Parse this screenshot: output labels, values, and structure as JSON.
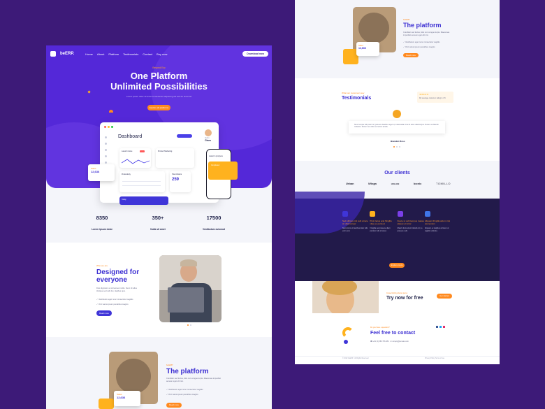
{
  "colors": {
    "background": "#3d1a78",
    "primary": "#5428d8",
    "accent": "#ff8a1f",
    "heading": "#3b2ed2"
  },
  "left": {
    "nav": {
      "logo": "beERP.",
      "items": [
        "Home",
        "About",
        "Platform",
        "Testimonials",
        "Contact",
        "Buy now"
      ],
      "cta": "Download now"
    },
    "hero": {
      "eyebrow": "Beyond Erp",
      "title_line1": "One Platform",
      "title_line2": "Unlimited Possibilities",
      "subtitle": "Lorem ipsum dolor sit amet consectetur adipiscing elit sed do eiusmod",
      "button": "Explore all platforms"
    },
    "dashboard": {
      "title": "Dashboard",
      "user_greeting": "Hello",
      "user_name": "Clara",
      "card1": "Latest Invoice",
      "card2": "Product Marketing",
      "card3": "Productivity",
      "card4": "Total Visitors",
      "metric": "259",
      "bottom_bar": "Today",
      "phone_card": "Latest in progress",
      "phone_status": "Completed"
    },
    "sales_card": {
      "label": "Sales",
      "value": "12,636"
    },
    "stats": [
      {
        "value": "8350",
        "label": "Lorem ipsum dolor"
      },
      {
        "value": "350+",
        "label": "Nulla sit amet"
      },
      {
        "value": "17500",
        "label": "Vestibulum euismod"
      }
    ],
    "designed": {
      "eyebrow": "Who we are",
      "title": "Designed for everyone",
      "text": "Duis dignissim et sit laoreet mollis. Nunc id tellus tristique sed velit dui, dapibus quis.",
      "checks": [
        "Vestibulum eget nunc consectetur sagittis",
        "Orci varius ipsum penatibus magnis"
      ],
      "button": "Read more"
    },
    "platform": {
      "eyebrow": "beERP",
      "title": "The platform",
      "text": "Curabitur sed luctus, felis non congue turpis. Maecenas imperdiet aenean eget elit nisi.",
      "checks": [
        "Vestibulum eget nunc consectetur sagittis",
        "Orci varius ipsum penatibus magnis"
      ],
      "button": "Read more",
      "sales_label": "Sales",
      "sales_value": "12,636"
    }
  },
  "right": {
    "platform": {
      "eyebrow": "beERP",
      "title": "The platform",
      "text": "Curabitur sed luctus, felis non congue turpis. Maecenas imperdiet aenean eget elit nisi.",
      "checks": [
        "Vestibulum eget nunc consectetur sagittis",
        "Orci varius ipsum penatibus magnis"
      ],
      "button": "Read more",
      "sales_label": "Sales",
      "sales_value": "12,636"
    },
    "testimonials": {
      "eyebrow": "What our customers say",
      "title": "Testimonials",
      "rating_text": "My average customer rating is 4.5",
      "quote": "Nunc tempor elit ipsum sit, posuere faucibus eget ut, malesuada urna sit amet ullamcorper. Donec vel blandit molestie. Donec nec odio nec lectus iaculis.",
      "author": "Brandon Ross"
    },
    "clients": {
      "title": "Our clients",
      "logos": [
        "Urban",
        "Wings",
        "HOLLEN",
        "Iconic",
        "TOMILLO"
      ]
    },
    "features": [
      {
        "title": "Sed ultrices nisl velit ornare sit ullamcorper",
        "text": "Nam lorem ut faucibus diam felis enim erat."
      },
      {
        "title": "Proin lacus erat fringilla vitae eu porta at",
        "text": "Fringilla sed posuere diam pulvinar felis sit amet."
      },
      {
        "title": "Fusce ut velit tempus massa aliquet et tortor",
        "text": "Mauris fermentum blandit orci, a posuere velit."
      },
      {
        "title": "Aliquam fringilla odio in nisi elementum",
        "text": "Aliquam ex dapibus at lorem ut sagittis vehicula."
      }
    ],
    "features_button": "Explore more",
    "try": {
      "eyebrow": "Curae Morbi pulvinar purus",
      "title": "Try now for free",
      "button": "Get started"
    },
    "contact": {
      "eyebrow": "Do you have a question?",
      "title": "Feel free to contact",
      "phone": "+61 (0) 383 766 284",
      "email": "noreply@envato.com"
    },
    "footer": {
      "copyright": "© 2022 beERP - All Rights Reserved",
      "links": "Privacy Policy  Terms of use"
    }
  }
}
